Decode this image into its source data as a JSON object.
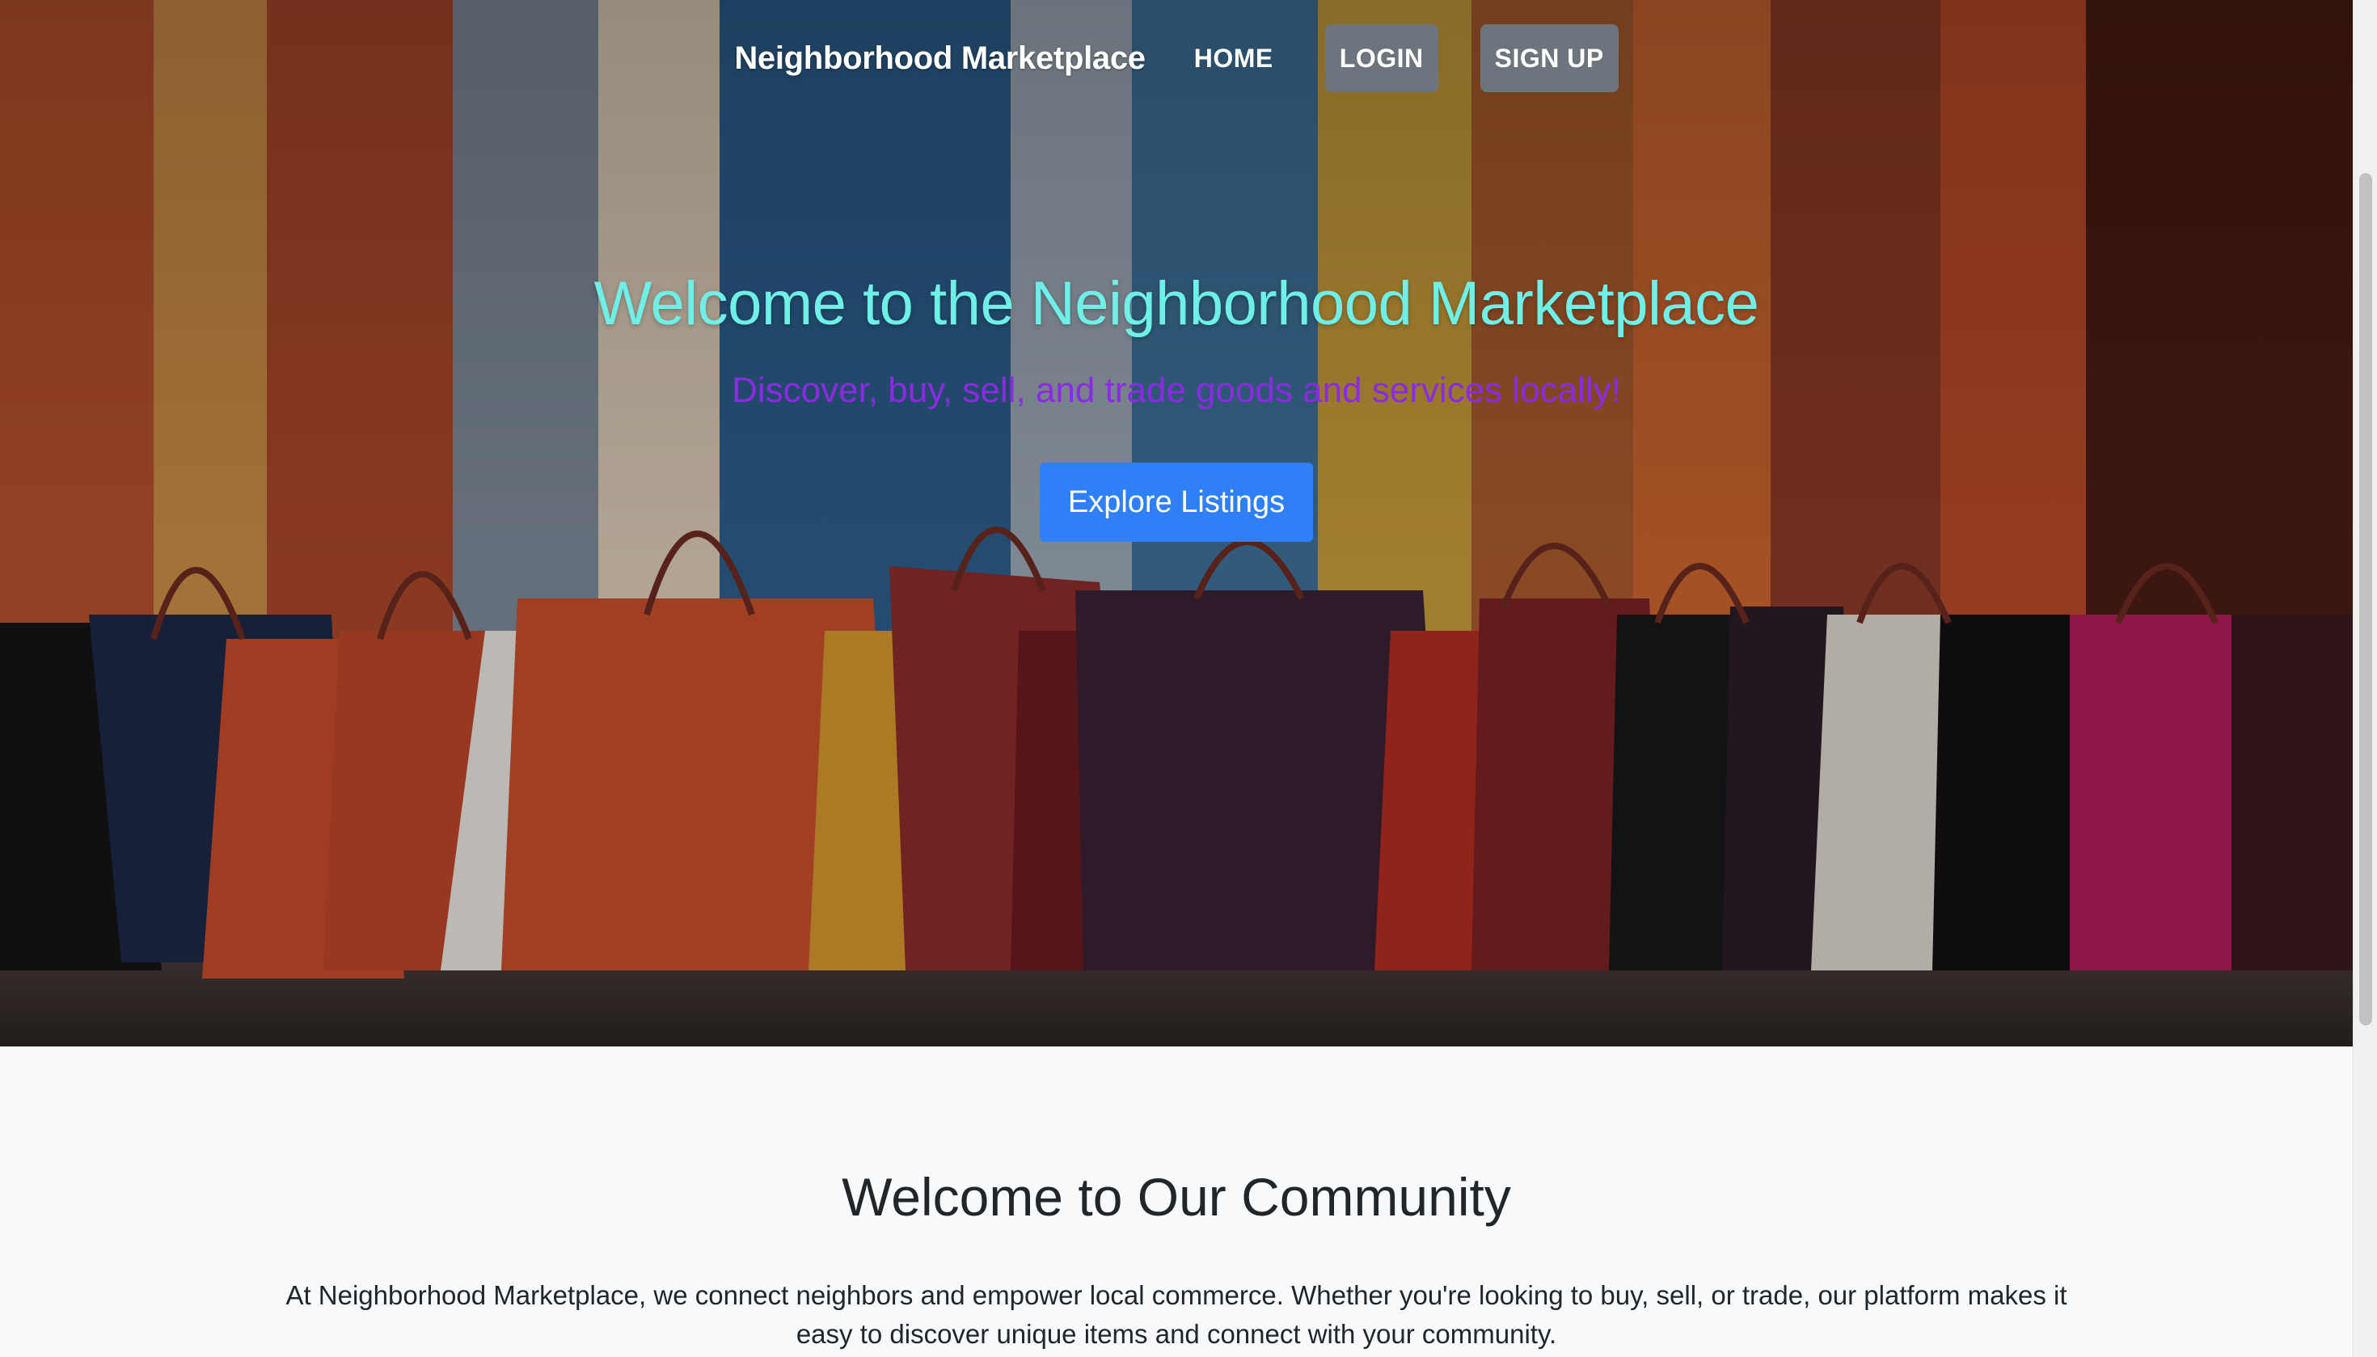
{
  "nav": {
    "brand": "Neighborhood Marketplace",
    "home": "HOME",
    "login": "LOGIN",
    "signup": "SIGN UP"
  },
  "hero": {
    "title": "Welcome to the Neighborhood Marketplace",
    "subtitle": "Discover, buy, sell, and trade goods and services locally!",
    "button": "Explore Listings",
    "background_image": "shopping-bags-photo"
  },
  "community": {
    "title": "Welcome to Our Community",
    "text": "At Neighborhood Marketplace, we connect neighbors and empower local commerce. Whether you're looking to buy, sell, or trade, our platform makes it easy to discover unique items and connect with your community."
  },
  "colors": {
    "hero_title": "#6ef0e8",
    "hero_subtitle": "#8a2be2",
    "primary_button": "#2f80f7",
    "nav_button": "#6c757d",
    "page_background": "#f8f9fa"
  }
}
